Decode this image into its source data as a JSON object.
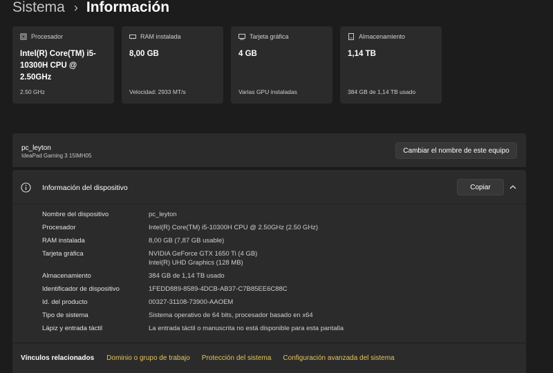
{
  "breadcrumb": {
    "parent": "Sistema",
    "separator": "›",
    "current": "Información"
  },
  "cards": [
    {
      "icon": "processor-icon",
      "label": "Procesador",
      "value": "Intel(R) Core(TM) i5-10300H CPU @ 2.50GHz",
      "sub": "2.50 GHz"
    },
    {
      "icon": "ram-icon",
      "label": "RAM instalada",
      "value": "8,00 GB",
      "sub": "Velocidad: 2933 MT/s"
    },
    {
      "icon": "gpu-icon",
      "label": "Tarjeta gráfica",
      "value": "4 GB",
      "sub": "Varias GPU instaladas"
    },
    {
      "icon": "storage-icon",
      "label": "Almacenamiento",
      "value": "1,14 TB",
      "sub": "384 GB de 1,14 TB usado"
    }
  ],
  "device": {
    "name": "pc_leyton",
    "model": "IdeaPad Gaming 3 15IMH05",
    "rename_label": "Cambiar el nombre de este equipo"
  },
  "info": {
    "title": "Información del dispositivo",
    "copy_label": "Copiar",
    "rows": [
      {
        "label": "Nombre del dispositivo",
        "value": "pc_leyton"
      },
      {
        "label": "Procesador",
        "value": "Intel(R) Core(TM) i5-10300H CPU @ 2.50GHz (2.50 GHz)"
      },
      {
        "label": "RAM instalada",
        "value": "8,00 GB (7,87 GB usable)"
      },
      {
        "label": "Tarjeta gráfica",
        "value": "NVIDIA GeForce GTX 1650 Ti (4 GB)",
        "value2": "Intel(R) UHD Graphics (128 MB)"
      },
      {
        "label": "Almacenamiento",
        "value": "384 GB de 1,14 TB usado"
      },
      {
        "label": "Identificador de dispositivo",
        "value": "1FEDD889-8589-4DCB-AB37-C7B85EE6C88C"
      },
      {
        "label": "Id. del producto",
        "value": "00327-31108-73900-AAOEM"
      },
      {
        "label": "Tipo de sistema",
        "value": "Sistema operativo de 64 bits, procesador basado en x64"
      },
      {
        "label": "Lápiz y entrada táctil",
        "value": "La entrada táctil o manuscrita no está disponible para esta pantalla"
      }
    ]
  },
  "related": {
    "label": "Vínculos relacionados",
    "links": [
      "Dominio o grupo de trabajo",
      "Protección del sistema",
      "Configuración avanzada del sistema"
    ]
  },
  "colors": {
    "background": "#1c1c1c",
    "card": "#2b2b2b",
    "link": "#e8c45a"
  }
}
